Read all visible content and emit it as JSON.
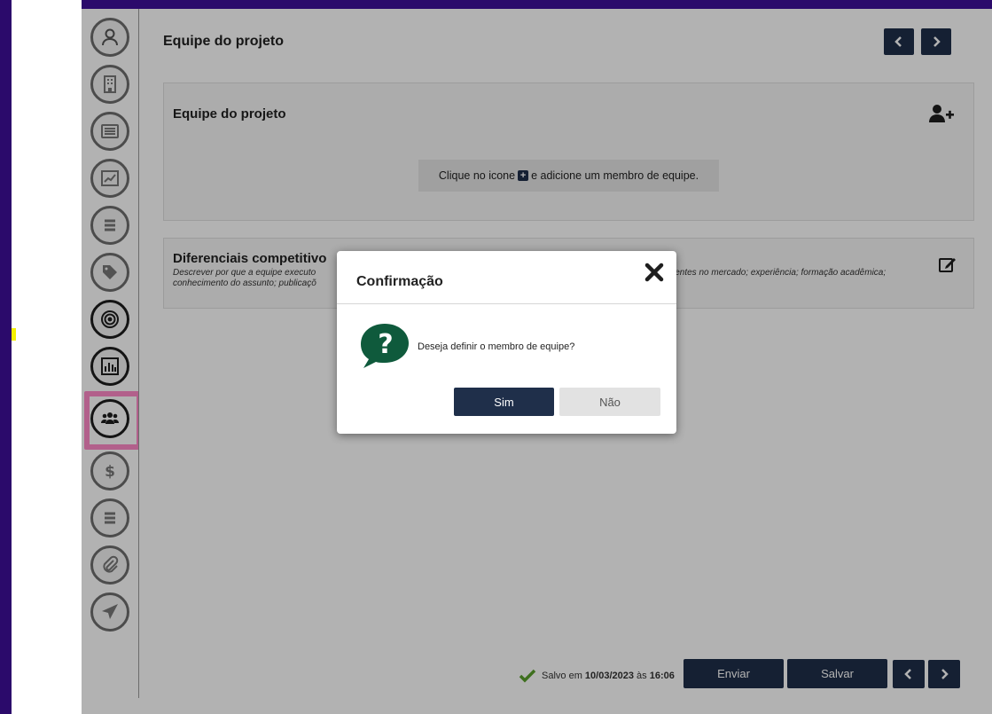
{
  "page": {
    "title": "Equipe do projeto"
  },
  "sidebar": {
    "items": [
      {
        "icon": "user-icon"
      },
      {
        "icon": "building-icon"
      },
      {
        "icon": "list-card-icon"
      },
      {
        "icon": "chart-line-icon"
      },
      {
        "icon": "list-icon"
      },
      {
        "icon": "tag-icon"
      },
      {
        "icon": "target-icon"
      },
      {
        "icon": "bar-chart-icon"
      },
      {
        "icon": "users-icon",
        "active": true
      },
      {
        "icon": "dollar-icon"
      },
      {
        "icon": "list-icon"
      },
      {
        "icon": "paperclip-icon"
      },
      {
        "icon": "send-icon"
      }
    ]
  },
  "team_card": {
    "title": "Equipe do projeto",
    "hint_before": "Clique no icone",
    "hint_after": "e adicione um membro de equipe."
  },
  "diff_card": {
    "title": "Diferenciais competitivo",
    "desc_line1_left": "Descrever por que a equipe executo",
    "desc_line1_right": "xistentes no mercado; experiência; formação acadêmica;",
    "desc_line2": "conhecimento do assunto; publicaçõ"
  },
  "footer": {
    "saved_prefix": "Salvo em",
    "saved_date": "10/03/2023",
    "saved_mid": "às",
    "saved_time": "16:06",
    "send_label": "Enviar",
    "save_label": "Salvar"
  },
  "modal": {
    "title": "Confirmação",
    "message": "Deseja definir o membro de equipe?",
    "yes_label": "Sim",
    "no_label": "Não"
  },
  "colors": {
    "primary": "#1f2f4a",
    "background": "#2b0a6b",
    "highlight": "#ff8ac8",
    "success": "#5aa02c",
    "question": "#0f5a3c"
  }
}
